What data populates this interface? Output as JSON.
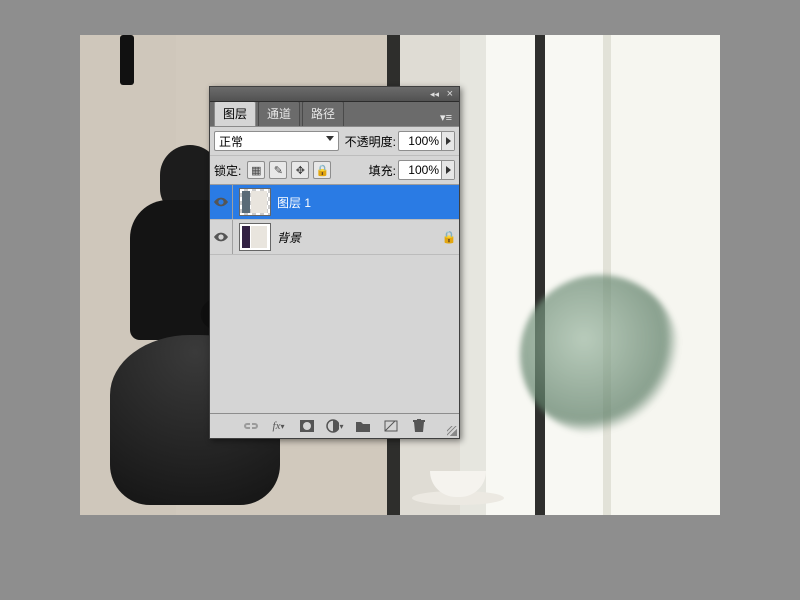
{
  "panel": {
    "tabs": [
      "图层",
      "通道",
      "路径"
    ],
    "active_tab": 0,
    "blend_mode": {
      "value": "正常"
    },
    "opacity": {
      "label": "不透明度:",
      "value": "100%"
    },
    "lock": {
      "label": "锁定:"
    },
    "fill": {
      "label": "填充:",
      "value": "100%"
    }
  },
  "lock_icons": [
    "transparent-pixels-icon",
    "brush-icon",
    "move-icon",
    "lock-all-icon"
  ],
  "layers": [
    {
      "name": "图层 1",
      "visible": true,
      "selected": true,
      "locked": false,
      "thumb": "transparent",
      "italic": false
    },
    {
      "name": "背景",
      "visible": true,
      "selected": false,
      "locked": true,
      "thumb": "photo",
      "italic": true
    }
  ],
  "footer_icons": [
    {
      "name": "link-icon",
      "enabled": false
    },
    {
      "name": "fx-icon",
      "enabled": true
    },
    {
      "name": "mask-icon",
      "enabled": true
    },
    {
      "name": "adjustment-icon",
      "enabled": true
    },
    {
      "name": "group-icon",
      "enabled": true
    },
    {
      "name": "new-layer-icon",
      "enabled": true
    },
    {
      "name": "trash-icon",
      "enabled": true
    }
  ]
}
